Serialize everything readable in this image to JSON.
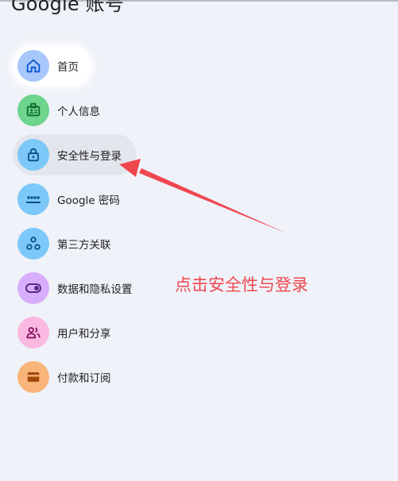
{
  "header": {
    "title": "Google 账号"
  },
  "nav": {
    "items": [
      {
        "label": "首页",
        "icon": "home-icon",
        "color": "#a8c7fa"
      },
      {
        "label": "个人信息",
        "icon": "id-card-icon",
        "color": "#6dd58c"
      },
      {
        "label": "安全性与登录",
        "icon": "lock-icon",
        "color": "#7cc8f8"
      },
      {
        "label": "Google 密码",
        "icon": "password-dots-icon",
        "color": "#7cc8f8"
      },
      {
        "label": "第三方关联",
        "icon": "connections-icon",
        "color": "#7cc8f8"
      },
      {
        "label": "数据和隐私设置",
        "icon": "toggle-icon",
        "color": "#d7aefb"
      },
      {
        "label": "用户和分享",
        "icon": "people-icon",
        "color": "#fbb8e0"
      },
      {
        "label": "付款和订阅",
        "icon": "wallet-icon",
        "color": "#f9b47a"
      }
    ]
  },
  "annotation": {
    "text": "点击安全性与登录",
    "color": "#f0474f"
  }
}
